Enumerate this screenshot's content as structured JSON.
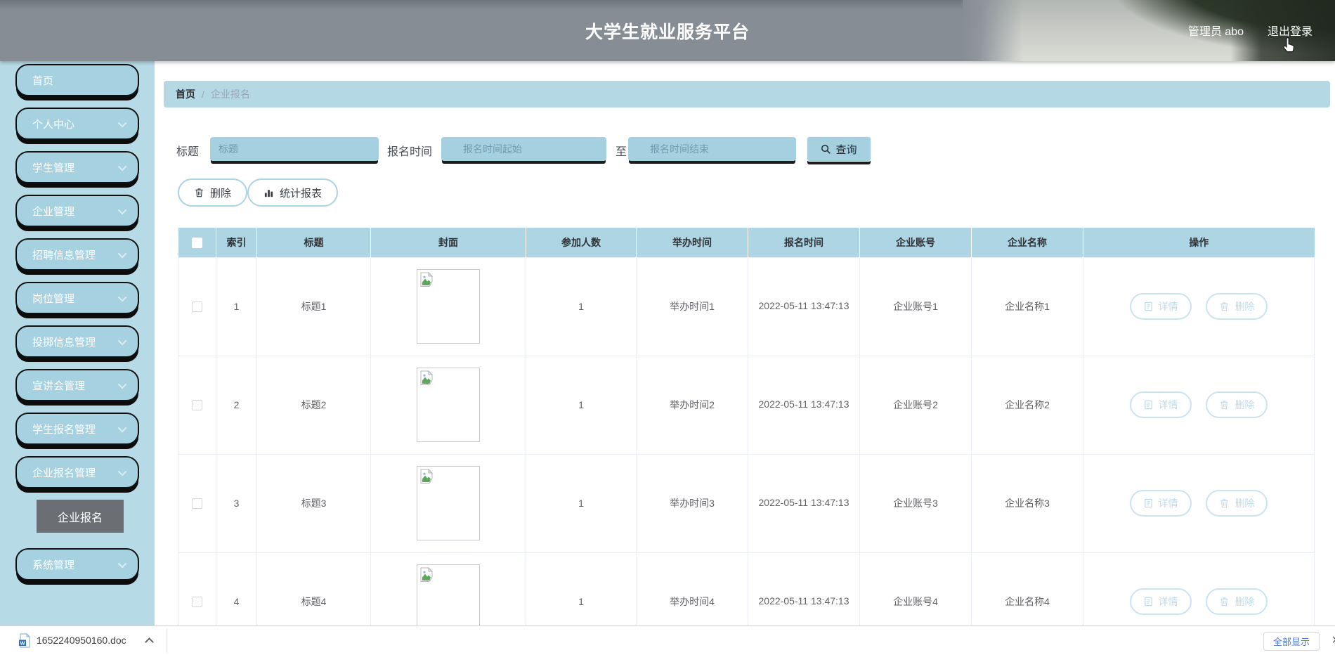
{
  "header": {
    "title": "大学生就业服务平台",
    "user_label": "管理员 abo",
    "logout_label": "退出登录"
  },
  "sidebar": {
    "items": [
      "首页",
      "个人中心",
      "学生管理",
      "企业管理",
      "招聘信息管理",
      "岗位管理",
      "投掷信息管理",
      "宣讲会管理",
      "学生报名管理",
      "企业报名管理",
      "系统管理"
    ],
    "submenu_item": "企业报名"
  },
  "breadcrumb": {
    "home": "首页",
    "separator": "/",
    "current": "企业报名"
  },
  "filters": {
    "title_label": "标题",
    "title_placeholder": "标题",
    "time_label": "报名时间",
    "time_start_placeholder": "报名时间起始",
    "to_label": "至",
    "time_end_placeholder": "报名时间结束",
    "search_label": "查询"
  },
  "toolbar": {
    "delete_label": "删除",
    "report_label": "统计报表"
  },
  "table": {
    "columns": [
      "索引",
      "标题",
      "封面",
      "参加人数",
      "举办时间",
      "报名时间",
      "企业账号",
      "企业名称",
      "操作"
    ],
    "detail_label": "详情",
    "row_delete_label": "删除",
    "rows": [
      {
        "index": "1",
        "title": "标题1",
        "participants": "1",
        "hold_time": "举办时间1",
        "signup_time": "2022-05-11 13:47:13",
        "account": "企业账号1",
        "company": "企业名称1"
      },
      {
        "index": "2",
        "title": "标题2",
        "participants": "1",
        "hold_time": "举办时间2",
        "signup_time": "2022-05-11 13:47:13",
        "account": "企业账号2",
        "company": "企业名称2"
      },
      {
        "index": "3",
        "title": "标题3",
        "participants": "1",
        "hold_time": "举办时间3",
        "signup_time": "2022-05-11 13:47:13",
        "account": "企业账号3",
        "company": "企业名称3"
      },
      {
        "index": "4",
        "title": "标题4",
        "participants": "1",
        "hold_time": "举办时间4",
        "signup_time": "2022-05-11 13:47:13",
        "account": "企业账号4",
        "company": "企业名称4"
      }
    ]
  },
  "download_bar": {
    "filename": "1652240950160.doc",
    "show_all_label": "全部显示"
  },
  "colors": {
    "header_bg": "#868d94",
    "sidebar_bg": "#b6dae6",
    "accent_light_blue": "#a5d1e1",
    "table_header_bg": "#aed5e3",
    "link_blue": "#4678d9",
    "submenu_gray": "#6b6e72"
  }
}
